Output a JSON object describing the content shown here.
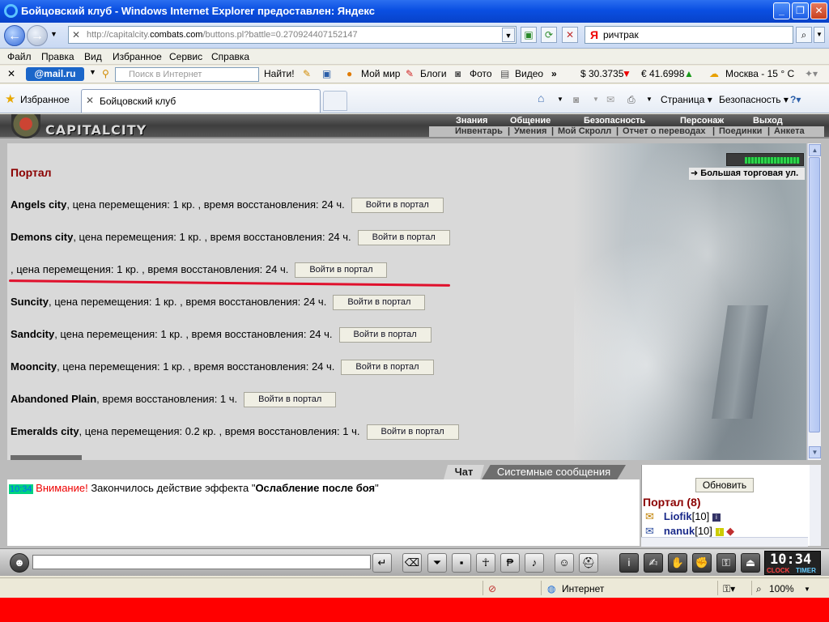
{
  "window": {
    "title": "Бойцовский клуб - Windows Internet Explorer предоставлен: Яндекс"
  },
  "address": {
    "url_prefix": "http://capitalcity.",
    "url_domain": "combats.com",
    "url_suffix": "/buttons.pl?battle=0.270924407152147",
    "search_value": "ричтрак"
  },
  "menu": {
    "items": [
      "Файл",
      "Правка",
      "Вид",
      "Избранное",
      "Сервис",
      "Справка"
    ]
  },
  "mailbar": {
    "logo": "@mail.ru",
    "search_placeholder": "Поиск в Интернет",
    "find": "Найти!",
    "myworld": "Мой мир",
    "blogs": "Блоги",
    "photo": "Фото",
    "video": "Видео",
    "usd": "$ 30.3735",
    "eur": "€ 41.6998",
    "weather": "Москва - 15 ° C"
  },
  "favbar": {
    "favorites": "Избранное",
    "tab_title": "Бойцовский клуб",
    "page": "Страница",
    "safety": "Безопасность"
  },
  "game": {
    "logo": "CAPITALCITY",
    "topnav": [
      "Знания",
      "Общение",
      "Безопасность",
      "Персонаж",
      "Выход"
    ],
    "subnav": [
      "Инвентарь",
      "Умения",
      "Мой Скролл",
      "Отчет о переводах",
      "Поединки",
      "Анкета"
    ],
    "location_link": "Большая торговая ул."
  },
  "portal": {
    "title": "Портал",
    "button_label": "Войти в портал",
    "rows": [
      {
        "name": "Angels city",
        "details": ", цена перемещения: 1 кр. , время восстановления: 24 ч."
      },
      {
        "name": "Demons city",
        "details": ", цена перемещения: 1 кр. , время восстановления: 24 ч."
      },
      {
        "name": "",
        "details": ", цена перемещения: 1 кр. , время восстановления: 24 ч."
      },
      {
        "name": "Suncity",
        "details": ", цена перемещения: 1 кр. , время восстановления: 24 ч."
      },
      {
        "name": "Sandcity",
        "details": ", цена перемещения: 1 кр. , время восстановления: 24 ч."
      },
      {
        "name": "Mooncity",
        "details": ", цена перемещения: 1 кр. , время восстановления: 24 ч."
      },
      {
        "name": "Abandoned Plain",
        "details": ", время восстановления: 1 ч."
      },
      {
        "name": "Emeralds city",
        "details": ", цена перемещения: 0.2 кр. , время восстановления: 1 ч."
      }
    ]
  },
  "chat": {
    "tab_chat": "Чат",
    "tab_system": "Системные сообщения",
    "time": "10:34",
    "warning": "Внимание!",
    "message": " Закончилось действие эффекта \"",
    "effect": "Ослабление после боя",
    "quote_end": "\""
  },
  "side": {
    "refresh": "Обновить",
    "location": "Портал (8)",
    "users": [
      {
        "name": "Liofik",
        "level": "[10]"
      },
      {
        "name": "nanuk",
        "level": "[10]"
      }
    ]
  },
  "clock": {
    "time": "10:34",
    "clock_label": "CLOCK",
    "timer_label": "TIMER"
  },
  "status": {
    "zone": "Интернет",
    "zoom": "100%"
  },
  "colors": {
    "portal_title": "#8b0000",
    "annotation_line": "#e0102c",
    "bottom_band": "#ff0000"
  }
}
